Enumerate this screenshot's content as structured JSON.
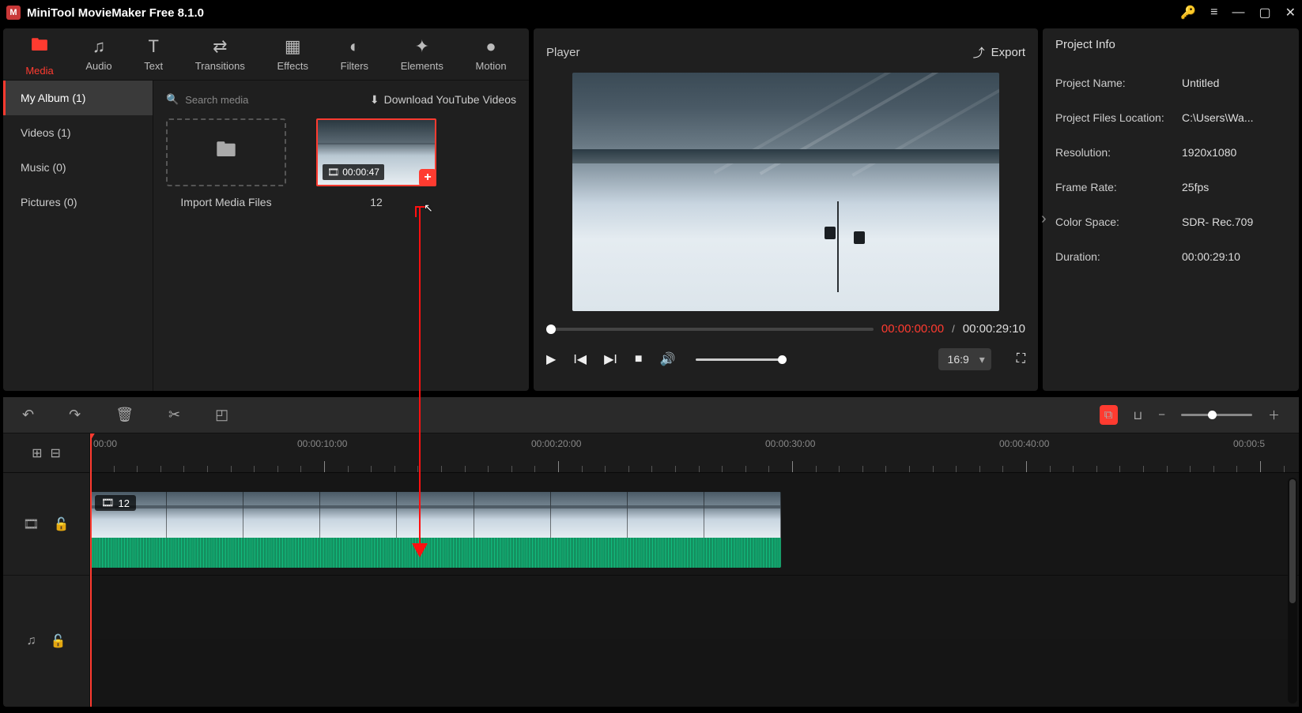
{
  "app": {
    "title": "MiniTool MovieMaker Free 8.1.0"
  },
  "tabs": {
    "media": "Media",
    "audio": "Audio",
    "text": "Text",
    "transitions": "Transitions",
    "effects": "Effects",
    "filters": "Filters",
    "elements": "Elements",
    "motion": "Motion"
  },
  "album": {
    "my_album": "My Album (1)",
    "videos": "Videos (1)",
    "music": "Music (0)",
    "pictures": "Pictures (0)"
  },
  "mediabar": {
    "search_placeholder": "Search media",
    "download_yt": "Download YouTube Videos"
  },
  "tiles": {
    "import_label": "Import Media Files",
    "clip_name": "12",
    "clip_duration": "00:00:47"
  },
  "player": {
    "title": "Player",
    "export": "Export",
    "current_time": "00:00:00:00",
    "total_time": "00:00:29:10",
    "ratio": "16:9"
  },
  "info": {
    "title": "Project Info",
    "labels": {
      "name": "Project Name:",
      "loc": "Project Files Location:",
      "res": "Resolution:",
      "fps": "Frame Rate:",
      "cs": "Color Space:",
      "dur": "Duration:"
    },
    "values": {
      "name": "Untitled",
      "loc": "C:\\Users\\Wa...",
      "res": "1920x1080",
      "fps": "25fps",
      "cs": "SDR- Rec.709",
      "dur": "00:00:29:10"
    }
  },
  "ruler": {
    "t0": "00:00",
    "t10": "00:00:10:00",
    "t20": "00:00:20:00",
    "t30": "00:00:30:00",
    "t40": "00:00:40:00",
    "t50": "00:00:5"
  },
  "clip": {
    "label": "12"
  }
}
